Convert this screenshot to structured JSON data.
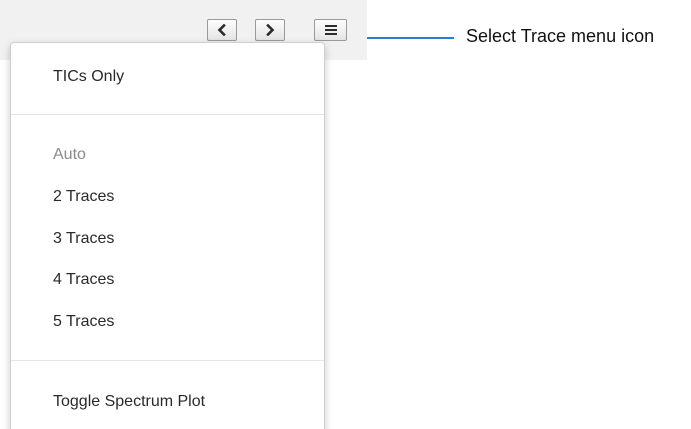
{
  "toolbar": {
    "buttons": [
      {
        "name": "previous",
        "icon": "chevron-left-icon"
      },
      {
        "name": "next",
        "icon": "chevron-right-icon"
      },
      {
        "name": "select-trace-menu",
        "icon": "hamburger-menu-icon"
      }
    ]
  },
  "menu": {
    "sections": [
      {
        "items": [
          {
            "label": "TICs Only",
            "enabled": true
          }
        ]
      },
      {
        "items": [
          {
            "label": "Auto",
            "enabled": false
          },
          {
            "label": "2 Traces",
            "enabled": true
          },
          {
            "label": "3 Traces",
            "enabled": true
          },
          {
            "label": "4 Traces",
            "enabled": true
          },
          {
            "label": "5 Traces",
            "enabled": true
          }
        ]
      },
      {
        "items": [
          {
            "label": "Toggle Spectrum Plot",
            "enabled": true
          }
        ]
      }
    ]
  },
  "callout": {
    "label": "Select Trace menu icon",
    "line_color": "#2a7fd0"
  }
}
